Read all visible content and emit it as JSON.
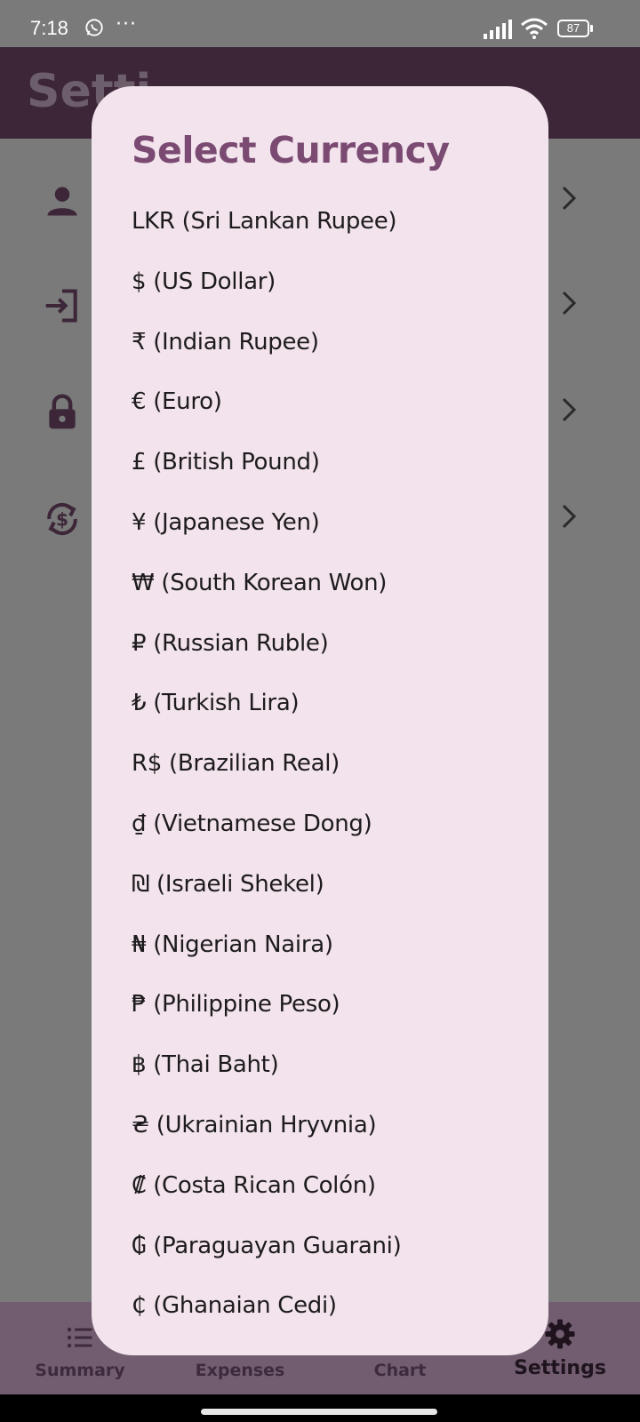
{
  "status_bar": {
    "time": "7:18",
    "more_indicator": "···",
    "battery": "87",
    "icons": [
      "whatsapp-icon",
      "signal-icon",
      "wifi-icon",
      "battery-icon"
    ]
  },
  "app_bar": {
    "title": "Setti"
  },
  "settings": {
    "items": [
      {
        "icon": "person-icon"
      },
      {
        "icon": "login-icon"
      },
      {
        "icon": "lock-icon"
      },
      {
        "icon": "currency-exchange-icon"
      }
    ]
  },
  "dialog": {
    "title": "Select Currency",
    "options": [
      "LKR (Sri Lankan Rupee)",
      "$ (US Dollar)",
      "₹ (Indian Rupee)",
      "€ (Euro)",
      "£ (British Pound)",
      "¥ (Japanese Yen)",
      "₩ (South Korean Won)",
      "₽ (Russian Ruble)",
      "₺ (Turkish Lira)",
      "R$ (Brazilian Real)",
      "₫ (Vietnamese Dong)",
      "₪ (Israeli Shekel)",
      "₦ (Nigerian Naira)",
      "₱ (Philippine Peso)",
      "฿ (Thai Baht)",
      "₴ (Ukrainian Hryvnia)",
      "₡ (Costa Rican Colón)",
      "₲ (Paraguayan Guarani)",
      "₵ (Ghanaian Cedi)"
    ]
  },
  "bottom_nav": {
    "items": [
      {
        "label": "Summary",
        "icon": "list-icon"
      },
      {
        "label": "Expenses",
        "icon": "expenses-icon"
      },
      {
        "label": "Chart",
        "icon": "chart-icon"
      },
      {
        "label": "Settings",
        "icon": "gear-icon",
        "active": true
      }
    ]
  },
  "colors": {
    "scrim": "#7a7a7a",
    "app_bar": "#3c2638",
    "dialog_bg": "#f2e3ec",
    "dialog_title": "#7a4a72",
    "nav_bg": "#715d6f"
  }
}
